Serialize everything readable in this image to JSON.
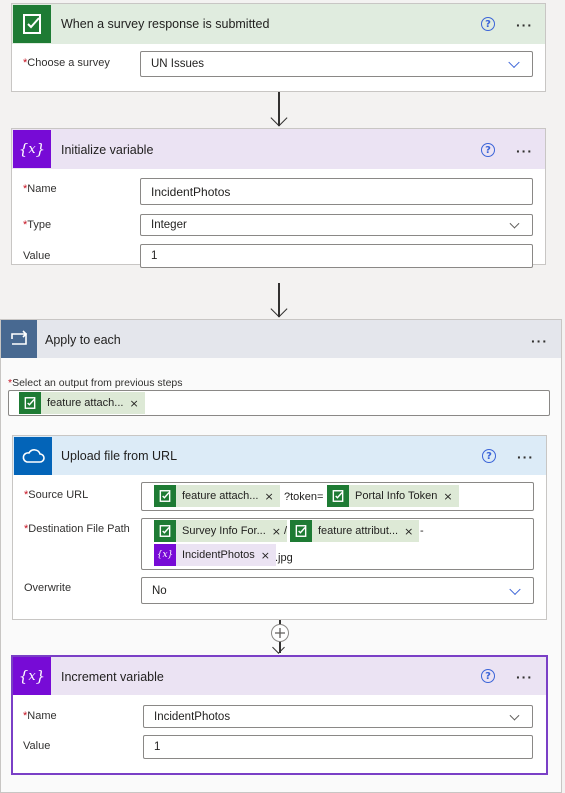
{
  "trigger": {
    "title": "When a survey response is submitted",
    "icon": "survey-icon",
    "fields": {
      "survey_label": "Choose a survey",
      "survey_value": "UN Issues"
    }
  },
  "init_var": {
    "title": "Initialize variable",
    "icon": "variable-icon",
    "name_label": "Name",
    "name_value": "IncidentPhotos",
    "type_label": "Type",
    "type_value": "Integer",
    "value_label": "Value",
    "value_value": "1"
  },
  "apply_each": {
    "title": "Apply to each",
    "icon": "loop-icon",
    "select_label": "Select an output from previous steps",
    "token": "feature attach..."
  },
  "upload": {
    "title": "Upload file from URL",
    "icon": "onedrive-icon",
    "source_label": "Source URL",
    "source_token1": "feature attach...",
    "source_sep": "?token=",
    "source_token2": "Portal Info Token",
    "dest_label": "Destination File Path",
    "dest_token1": "Survey Info For...",
    "dest_sep": "/",
    "dest_token2": "feature attribut...",
    "dest_dash": "-",
    "dest_token3": "IncidentPhotos",
    "dest_ext": ".jpg",
    "overwrite_label": "Overwrite",
    "overwrite_value": "No"
  },
  "increment": {
    "title": "Increment variable",
    "icon": "variable-icon",
    "name_label": "Name",
    "name_value": "IncidentPhotos",
    "value_label": "Value",
    "value_value": "1"
  },
  "common": {
    "help": "?",
    "more": "···",
    "remove": "×",
    "required": "*"
  },
  "colors": {
    "survey_green": "#1e7b34",
    "variable_purple": "#770bd6",
    "loop_blue": "#486991",
    "onedrive_blue": "#0364b8"
  }
}
